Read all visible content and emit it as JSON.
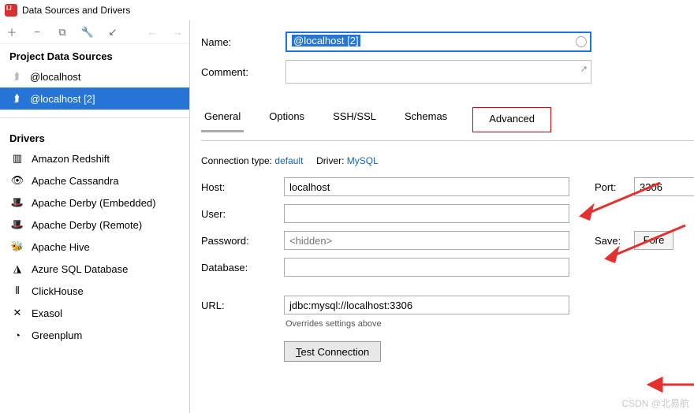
{
  "window": {
    "title": "Data Sources and Drivers"
  },
  "sidebar": {
    "section1": "Project Data Sources",
    "items": [
      {
        "label": "@localhost",
        "selected": false
      },
      {
        "label": "@localhost [2]",
        "selected": true
      }
    ],
    "section2": "Drivers",
    "drivers": [
      {
        "label": "Amazon Redshift",
        "glyph": "▥"
      },
      {
        "label": "Apache Cassandra",
        "glyph": "👁"
      },
      {
        "label": "Apache Derby (Embedded)",
        "glyph": "🎩"
      },
      {
        "label": "Apache Derby (Remote)",
        "glyph": "🎩"
      },
      {
        "label": "Apache Hive",
        "glyph": "🐝"
      },
      {
        "label": "Azure SQL Database",
        "glyph": "◮"
      },
      {
        "label": "ClickHouse",
        "glyph": "⦀"
      },
      {
        "label": "Exasol",
        "glyph": "✕"
      },
      {
        "label": "Greenplum",
        "glyph": "◔"
      }
    ]
  },
  "form": {
    "name_label": "Name:",
    "name_value": "@localhost [2]",
    "comment_label": "Comment:",
    "tabs": [
      "General",
      "Options",
      "SSH/SSL",
      "Schemas",
      "Advanced"
    ],
    "active_tab": "General",
    "highlight_tab": "Advanced",
    "conn_type_label": "Connection type:",
    "conn_type_value": "default",
    "driver_label": "Driver:",
    "driver_value": "MySQL",
    "host_label": "Host:",
    "host_value": "localhost",
    "port_label": "Port:",
    "port_value": "3306",
    "user_label": "User:",
    "user_value": "",
    "password_label": "Password:",
    "password_placeholder": "<hidden>",
    "save_label": "Save:",
    "save_value": "Fore",
    "database_label": "Database:",
    "database_value": "",
    "url_label": "URL:",
    "url_value": "jdbc:mysql://localhost:3306",
    "url_note": "Overrides settings above",
    "test_btn": "Test Connection",
    "test_btn_ul": "T"
  },
  "credit": "CSDN @北易航"
}
